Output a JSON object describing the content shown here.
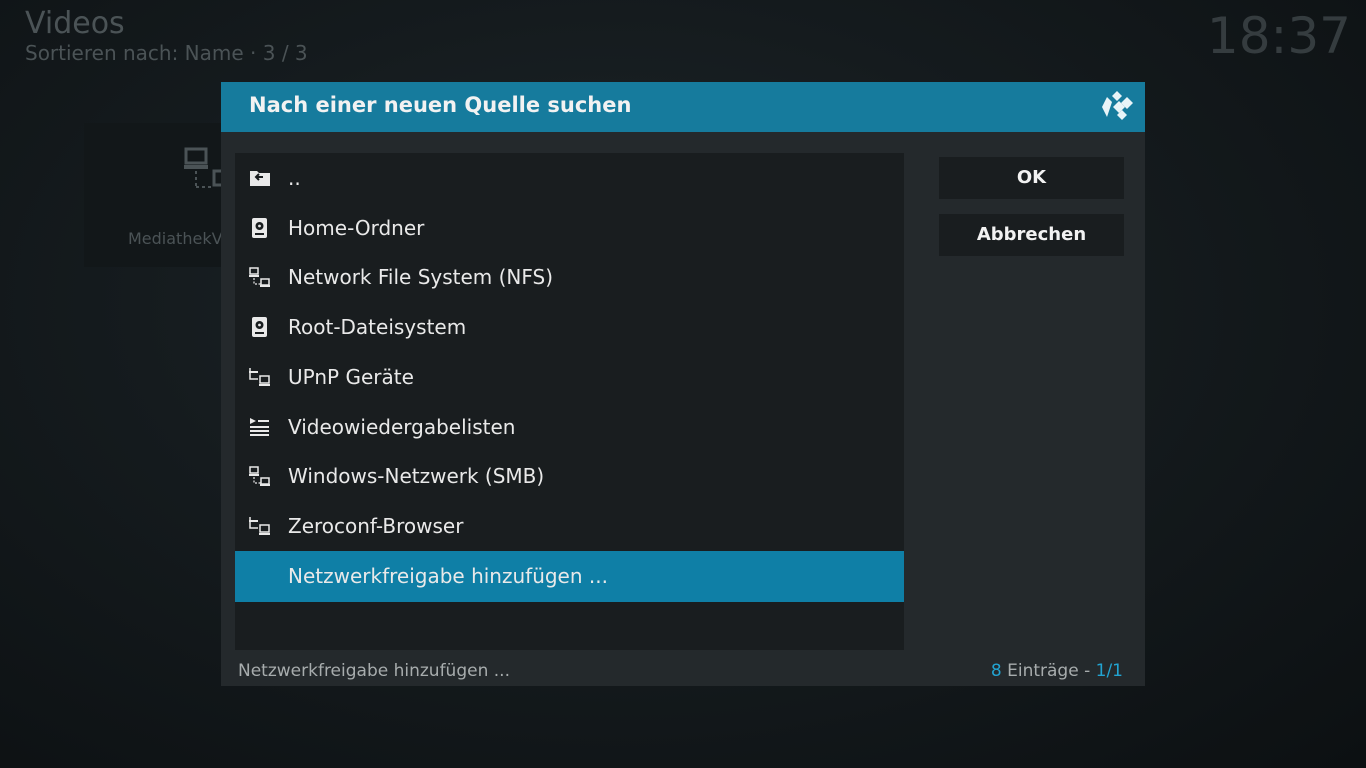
{
  "background": {
    "title": "Videos",
    "sort_text": "Sortieren nach: Name  ·  3 / 3",
    "clock": "18:37",
    "tile_label": "MediathekV"
  },
  "dialog": {
    "title": "Nach einer neuen Quelle suchen",
    "items": [
      {
        "label": "..",
        "icon": "folder-back-icon"
      },
      {
        "label": "Home-Ordner",
        "icon": "hard-drive-icon"
      },
      {
        "label": "Network File System (NFS)",
        "icon": "network-icon"
      },
      {
        "label": "Root-Dateisystem",
        "icon": "hard-drive-icon"
      },
      {
        "label": "UPnP Geräte",
        "icon": "network-icon"
      },
      {
        "label": "Videowiedergabelisten",
        "icon": "playlist-icon"
      },
      {
        "label": "Windows-Netzwerk (SMB)",
        "icon": "network-icon"
      },
      {
        "label": "Zeroconf-Browser",
        "icon": "network-icon"
      },
      {
        "label": "Netzwerkfreigabe hinzufügen ...",
        "icon": "",
        "selected": true
      }
    ],
    "ok_label": "OK",
    "cancel_label": "Abbrechen",
    "footer_selected": "Netzwerkfreigabe hinzufügen ...",
    "footer_count": "8",
    "footer_entries_text": " Einträge - ",
    "footer_page": "1/1"
  },
  "colors": {
    "accent": "#22a3d1",
    "header": "#167b9d",
    "selection": "#0f7fa6"
  }
}
